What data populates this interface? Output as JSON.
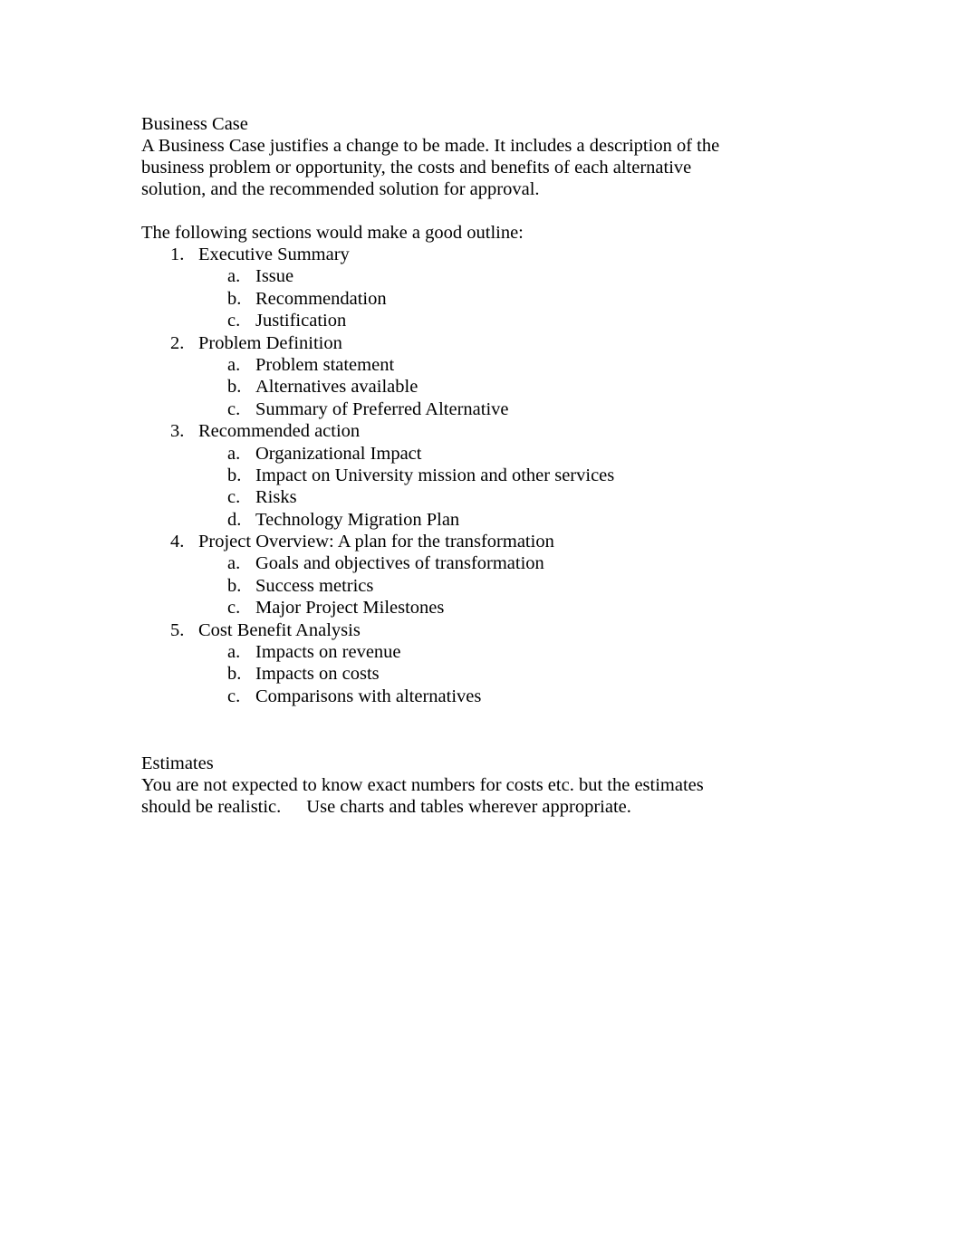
{
  "business_case": {
    "heading": "Business Case",
    "intro_lines": [
      "A Business Case justifies a change to be made. It includes a description of the",
      "business problem or opportunity, the costs and benefits of each alternative",
      "solution, and the recommended solution for approval."
    ],
    "outline_lead": "The following sections would make a good outline:"
  },
  "outline": [
    {
      "num": "1.",
      "label": "Executive Summary",
      "subs": [
        {
          "num": "a.",
          "label": "Issue"
        },
        {
          "num": "b.",
          "label": "Recommendation"
        },
        {
          "num": "c.",
          "label": "Justification"
        }
      ]
    },
    {
      "num": "2.",
      "label": "Problem Definition",
      "subs": [
        {
          "num": "a.",
          "label": "Problem statement"
        },
        {
          "num": "b.",
          "label": "Alternatives available"
        },
        {
          "num": "c.",
          "label": "Summary of Preferred Alternative"
        }
      ]
    },
    {
      "num": "3.",
      "label": "Recommended action",
      "subs": [
        {
          "num": "a.",
          "label": "Organizational Impact"
        },
        {
          "num": "b.",
          "label": "Impact on University mission and other services"
        },
        {
          "num": "c.",
          "label": "Risks"
        },
        {
          "num": "d.",
          "label": "Technology Migration Plan"
        }
      ]
    },
    {
      "num": "4.",
      "label": "Project Overview: A plan for the transformation",
      "subs": [
        {
          "num": "a.",
          "label": "Goals and objectives of transformation"
        },
        {
          "num": "b.",
          "label": "Success metrics"
        },
        {
          "num": "c.",
          "label": "Major Project Milestones"
        }
      ]
    },
    {
      "num": "5.",
      "label": "Cost Benefit Analysis",
      "subs": [
        {
          "num": "a.",
          "label": "Impacts on revenue"
        },
        {
          "num": "b.",
          "label": "Impacts on costs"
        },
        {
          "num": "c.",
          "label": "Comparisons with alternatives"
        }
      ]
    }
  ],
  "estimates": {
    "heading": "Estimates",
    "line1": "You are not expected to know exact numbers for costs etc. but the estimates",
    "line2a": "should be realistic.",
    "line2b": "Use charts and tables wherever appropriate."
  }
}
